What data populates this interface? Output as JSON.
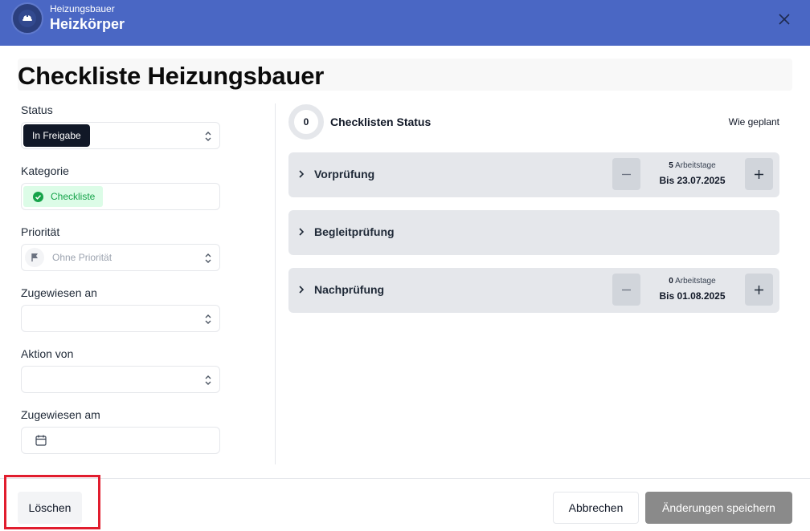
{
  "header": {
    "subtitle": "Heizungsbauer",
    "title": "Heizkörper"
  },
  "page": {
    "title": "Checkliste Heizungsbauer"
  },
  "form": {
    "status": {
      "label": "Status",
      "value": "In Freigabe"
    },
    "kategorie": {
      "label": "Kategorie",
      "value": "Checkliste"
    },
    "prioritaet": {
      "label": "Priorität",
      "value": "Ohne Priorität"
    },
    "zugewiesen_an": {
      "label": "Zugewiesen an",
      "value": ""
    },
    "aktion_von": {
      "label": "Aktion von",
      "value": ""
    },
    "zugewiesen_am": {
      "label": "Zugewiesen am",
      "value": ""
    }
  },
  "checklist": {
    "count": "0",
    "title": "Checklisten Status",
    "state": "Wie geplant",
    "sections": [
      {
        "label": "Vorprüfung",
        "days": "5",
        "days_unit": "Arbeitstage",
        "until": "Bis 23.07.2025"
      },
      {
        "label": "Begleitprüfung"
      },
      {
        "label": "Nachprüfung",
        "days": "0",
        "days_unit": "Arbeitstage",
        "until": "Bis 01.08.2025"
      }
    ]
  },
  "footer": {
    "delete_label": "Löschen",
    "cancel_label": "Abbrechen",
    "save_label": "Änderungen speichern"
  },
  "colors": {
    "header_bg": "#4a67c4",
    "highlight": "#e11d2e",
    "badge_green": "#16a34a",
    "save_disabled": "#8a8a8a"
  },
  "icons": [
    "hard-hat-icon",
    "close-icon",
    "chevron-updown-icon",
    "check-circle-icon",
    "flag-icon",
    "calendar-icon",
    "chevron-right-icon",
    "minus-icon",
    "plus-icon"
  ]
}
